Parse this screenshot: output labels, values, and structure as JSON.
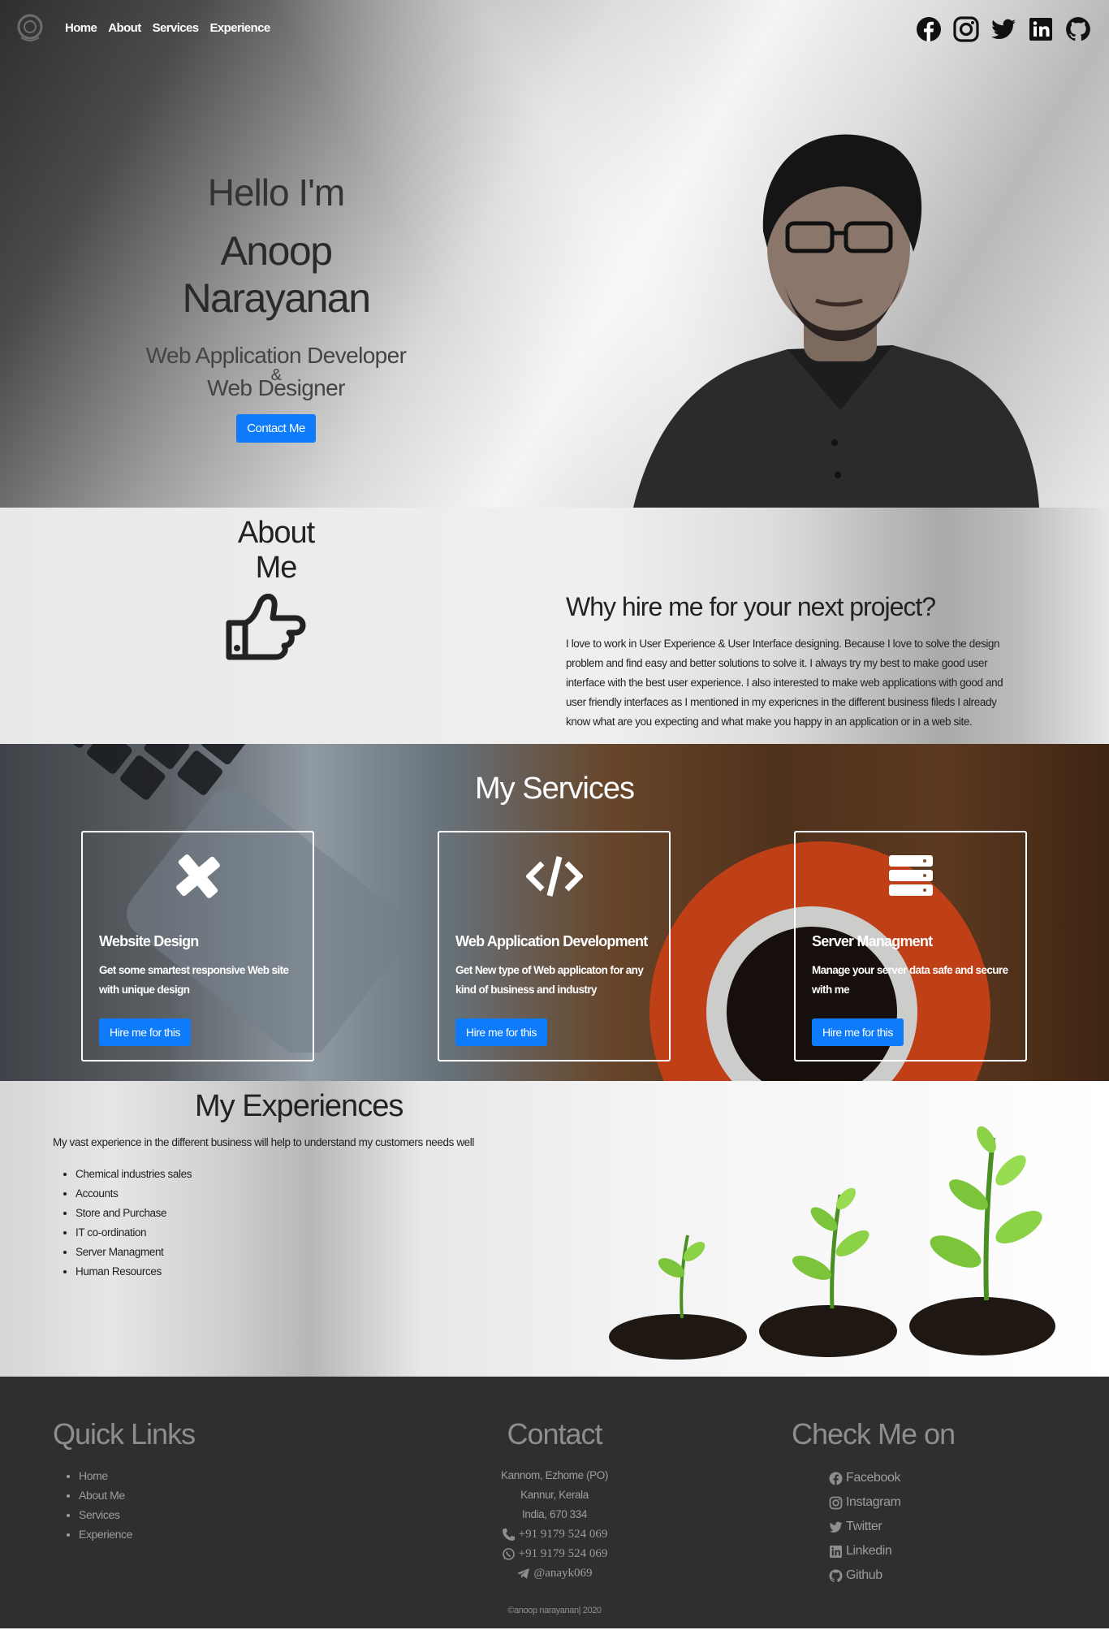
{
  "nav": {
    "links": [
      "Home",
      "About",
      "Services",
      "Experience"
    ],
    "socials": [
      "facebook-icon",
      "instagram-icon",
      "twitter-icon",
      "linkedin-icon",
      "github-icon"
    ]
  },
  "hero": {
    "greeting": "Hello I'm",
    "name": "Anoop Narayanan",
    "role_1": "Web Application Developer",
    "role_amp": "&",
    "role_2": "Web Designer",
    "cta": "Contact Me"
  },
  "about": {
    "title": "About Me",
    "heading": "Why hire me for your next project?",
    "body": "I love to work in User Experience & User Interface designing. Because I love to solve the design problem and find easy and better solutions to solve it. I always try my best to make good user interface with the best user experience. I also interested to make web applications with good and user friendly interfaces as I mentioned in my expericnes in the different business fileds I already know what are you expecting and what make you happy in an application or in a web site."
  },
  "services": {
    "title": "My Services",
    "cards": [
      {
        "title": "Website Design",
        "desc": "Get some smartest responsive Web site with unique design",
        "button": "Hire me for this",
        "icon": "design-tools-icon"
      },
      {
        "title": "Web Application Development",
        "desc": "Get New type of Web applicaton for any kind of business and industry",
        "button": "Hire me for this",
        "icon": "code-icon"
      },
      {
        "title": "Server Managment",
        "desc": "Manage your server data safe and secure with me",
        "button": "Hire me for this",
        "icon": "server-icon"
      }
    ]
  },
  "experience": {
    "title": "My Experiences",
    "lead": "My vast experience in the different business will help to understand my customers needs well",
    "items": [
      "Chemical industries sales",
      "Accounts",
      "Store and Purchase",
      "IT co-ordination",
      "Server Managment",
      "Human Resources"
    ]
  },
  "footer": {
    "quick_links_title": "Quick Links",
    "quick_links": [
      "Home",
      "About Me",
      "Services",
      "Experience"
    ],
    "contact_title": "Contact",
    "address": [
      "Kannom, Ezhome (PO)",
      "Kannur, Kerala",
      "India, 670 334"
    ],
    "phone": "+91 9179 524 069",
    "whatsapp": "+91 9179 524 069",
    "telegram": "@anayk069",
    "check_title": "Check Me on",
    "profiles": [
      "Facebook",
      "Instagram",
      "Twitter",
      "Linkedin",
      "Github"
    ],
    "copyright": "©anoop narayanan| 2020"
  }
}
